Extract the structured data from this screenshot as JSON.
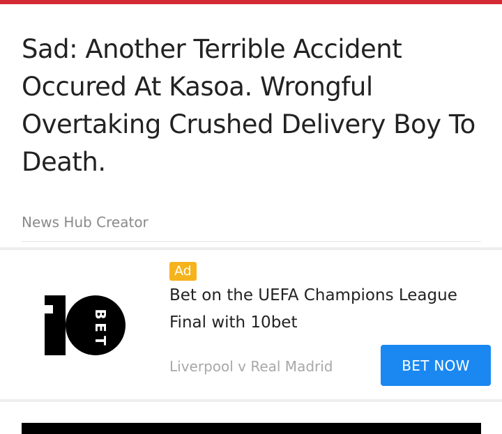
{
  "theme": {
    "accent": "#d42a34",
    "cta": "#1a88f0",
    "badge": "#f5b31c"
  },
  "article": {
    "title": "Sad: Another Terrible Accident Occured At Kasoa. Wrongful Overtaking Crushed Delivery Boy To Death.",
    "author": "News Hub Creator"
  },
  "ad": {
    "badge": "Ad",
    "logo_icon": "10bet-logo-icon",
    "logo_text": "BET",
    "title": "Bet on the UEFA Champions League Final with 10bet",
    "subtitle": "Liverpool v Real Madrid",
    "cta_label": "BET NOW"
  }
}
